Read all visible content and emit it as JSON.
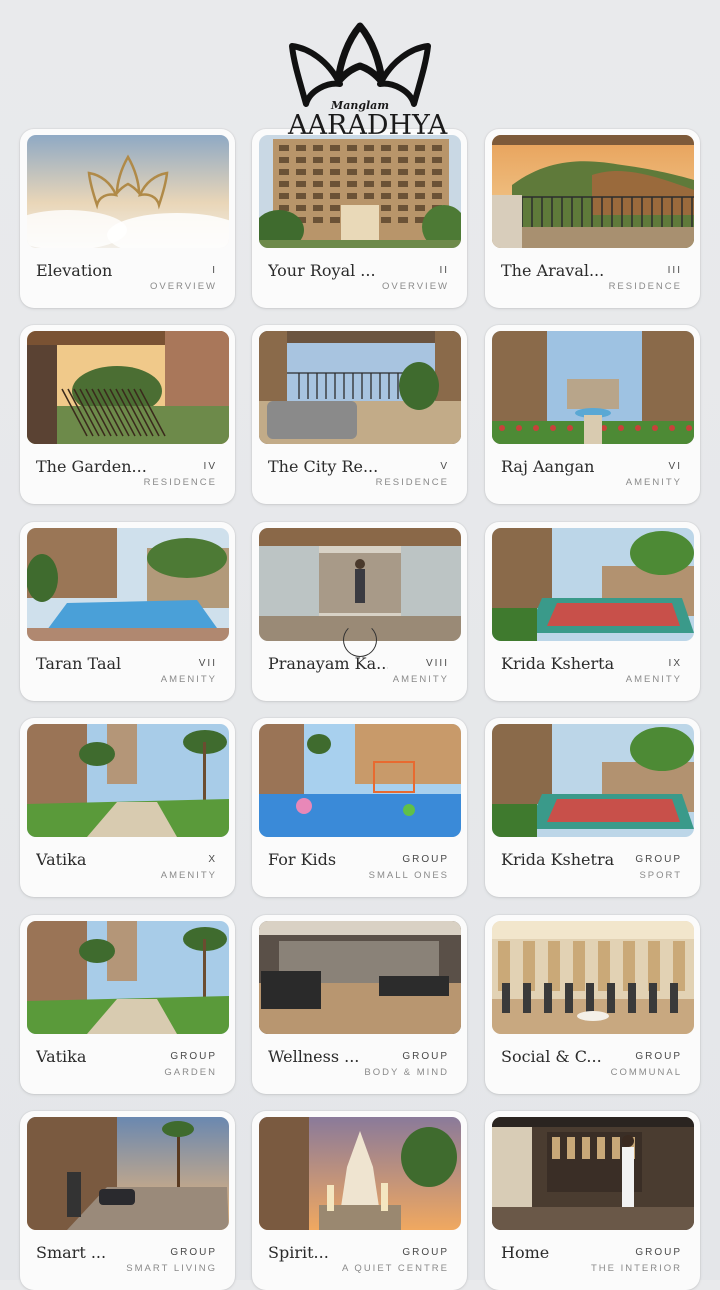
{
  "brand": {
    "sub": "Manglam",
    "name": "AARADHYA"
  },
  "cards": [
    {
      "title": "Elevation",
      "num": "I",
      "category": "OVERVIEW",
      "scene": "clouds"
    },
    {
      "title": "Your Royal ...",
      "num": "II",
      "category": "OVERVIEW",
      "scene": "building"
    },
    {
      "title": "The Araval...",
      "num": "III",
      "category": "RESIDENCE",
      "scene": "hills"
    },
    {
      "title": "The Garden...",
      "num": "IV",
      "category": "RESIDENCE",
      "scene": "balcony"
    },
    {
      "title": "The City Re...",
      "num": "V",
      "category": "RESIDENCE",
      "scene": "terrace"
    },
    {
      "title": "Raj Aangan",
      "num": "VI",
      "category": "AMENITY",
      "scene": "courtyard"
    },
    {
      "title": "Taran Taal",
      "num": "VII",
      "category": "AMENITY",
      "scene": "pool"
    },
    {
      "title": "Pranayam Ka...",
      "num": "VIII",
      "category": "AMENITY",
      "scene": "yoga"
    },
    {
      "title": "Krida Ksherta",
      "num": "IX",
      "category": "AMENITY",
      "scene": "court"
    },
    {
      "title": "Vatika",
      "num": "X",
      "category": "AMENITY",
      "scene": "garden"
    },
    {
      "title": "For Kids",
      "num": "GROUP",
      "category": "SMALL ONES",
      "scene": "kids"
    },
    {
      "title": "Krida Kshetra",
      "num": "GROUP",
      "category": "SPORT",
      "scene": "court"
    },
    {
      "title": "Vatika",
      "num": "GROUP",
      "category": "GARDEN",
      "scene": "garden"
    },
    {
      "title": "Wellness ...",
      "num": "GROUP",
      "category": "BODY & MIND",
      "scene": "gym"
    },
    {
      "title": "Social & C...",
      "num": "GROUP",
      "category": "COMMUNAL",
      "scene": "hall"
    },
    {
      "title": "Smart ...",
      "num": "GROUP",
      "category": "SMART LIVING",
      "scene": "entrance"
    },
    {
      "title": "Spirit...",
      "num": "GROUP",
      "category": "A QUIET CENTRE",
      "scene": "temple"
    },
    {
      "title": "Home",
      "num": "GROUP",
      "category": "THE INTERIOR",
      "scene": "interior"
    }
  ]
}
